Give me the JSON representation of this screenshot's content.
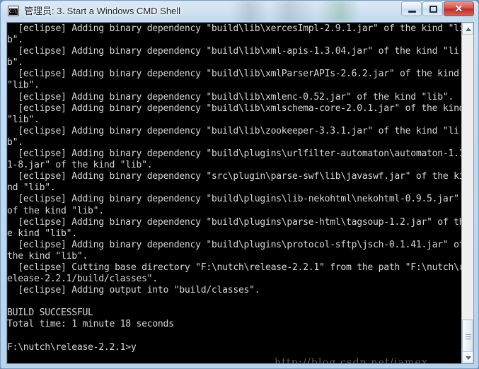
{
  "window": {
    "title": "管理员: 3. Start a Windows CMD Shell",
    "icon": "cmd-console-icon",
    "controls": {
      "minimize_label": "—",
      "maximize_label": "❐",
      "close_label": "✕"
    },
    "colors": {
      "console_bg": "#000000",
      "console_fg": "#d6d6d6",
      "frame": "#c3d9ee",
      "close_button": "#c5372f",
      "title_text": "#14232f"
    }
  },
  "console": {
    "prompt": "F:\\nutch\\release-2.2.1>",
    "typed_command": "y",
    "build_status": "BUILD SUCCESSFUL",
    "total_time": "Total time: 1 minute 18 seconds",
    "output": "  [eclipse] Adding binary dependency \"build\\lib\\xercesImpl-2.9.1.jar\" of the kind \"lib\".\n  [eclipse] Adding binary dependency \"build\\lib\\xml-apis-1.3.04.jar\" of the kind \"lib\".\n  [eclipse] Adding binary dependency \"build\\lib\\xmlParserAPIs-2.6.2.jar\" of the kind \"lib\".\n  [eclipse] Adding binary dependency \"build\\lib\\xmlenc-0.52.jar\" of the kind \"lib\".\n  [eclipse] Adding binary dependency \"build\\lib\\xmlschema-core-2.0.1.jar\" of the kind \"lib\".\n  [eclipse] Adding binary dependency \"build\\lib\\zookeeper-3.3.1.jar\" of the kind \"lib\".\n  [eclipse] Adding binary dependency \"build\\plugins\\urlfilter-automaton\\automaton-1.11-8.jar\" of the kind \"lib\".\n  [eclipse] Adding binary dependency \"src\\plugin\\parse-swf\\lib\\javaswf.jar\" of the kind \"lib\".\n  [eclipse] Adding binary dependency \"build\\plugins\\lib-nekohtml\\nekohtml-0.9.5.jar\" of the kind \"lib\".\n  [eclipse] Adding binary dependency \"build\\plugins\\parse-html\\tagsoup-1.2.jar\" of the kind \"lib\".\n  [eclipse] Adding binary dependency \"build\\plugins\\protocol-sftp\\jsch-0.1.41.jar\" of the kind \"lib\".\n  [eclipse] Cutting base directory \"F:\\nutch\\release-2.2.1\" from the path \"F:\\nutch\\release-2.2.1/build/classes\".\n  [eclipse] Adding output into \"build/classes\".\n\nBUILD SUCCESSFUL\nTotal time: 1 minute 18 seconds\n\nF:\\nutch\\release-2.2.1>y"
  },
  "watermark": {
    "text": "http://blog.csdn.net/jamex"
  },
  "scrollbar": {
    "up_arrow": "scroll-up-arrow",
    "down_arrow": "scroll-down-arrow",
    "position": "bottom"
  }
}
